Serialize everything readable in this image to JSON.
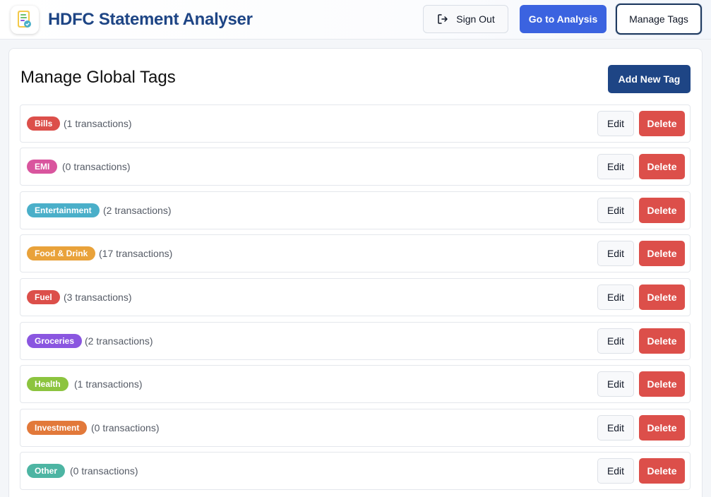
{
  "header": {
    "title": "HDFC Statement Analyser",
    "logo_icon": "statement-doc-icon",
    "sign_out_label": "Sign Out",
    "sign_out_icon": "sign-out-icon",
    "go_to_analysis_label": "Go to Analysis",
    "manage_tags_label": "Manage Tags"
  },
  "main": {
    "title": "Manage Global Tags",
    "add_button_label": "Add New Tag",
    "edit_label": "Edit",
    "delete_label": "Delete",
    "tags": [
      {
        "name": "Bills",
        "count": "(1 transactions)",
        "color": "#dc4f4a"
      },
      {
        "name": "EMI",
        "count": "(0 transactions)",
        "color": "#d9559e"
      },
      {
        "name": "Entertainment",
        "count": "(2 transactions)",
        "color": "#4aafc9"
      },
      {
        "name": "Food & Drink",
        "count": "(17 transactions)",
        "color": "#e9a23a"
      },
      {
        "name": "Fuel",
        "count": "(3 transactions)",
        "color": "#dc4f4a"
      },
      {
        "name": "Groceries",
        "count": "(2 transactions)",
        "color": "#8a56e0"
      },
      {
        "name": "Health",
        "count": "(1 transactions)",
        "color": "#8cc43f"
      },
      {
        "name": "Investment",
        "count": "(0 transactions)",
        "color": "#e2793a"
      },
      {
        "name": "Other",
        "count": "(0 transactions)",
        "color": "#4db5a3"
      }
    ]
  },
  "colors": {
    "brand": "#1e4585",
    "primary": "#3b63e0",
    "danger": "#dc4f4a"
  }
}
